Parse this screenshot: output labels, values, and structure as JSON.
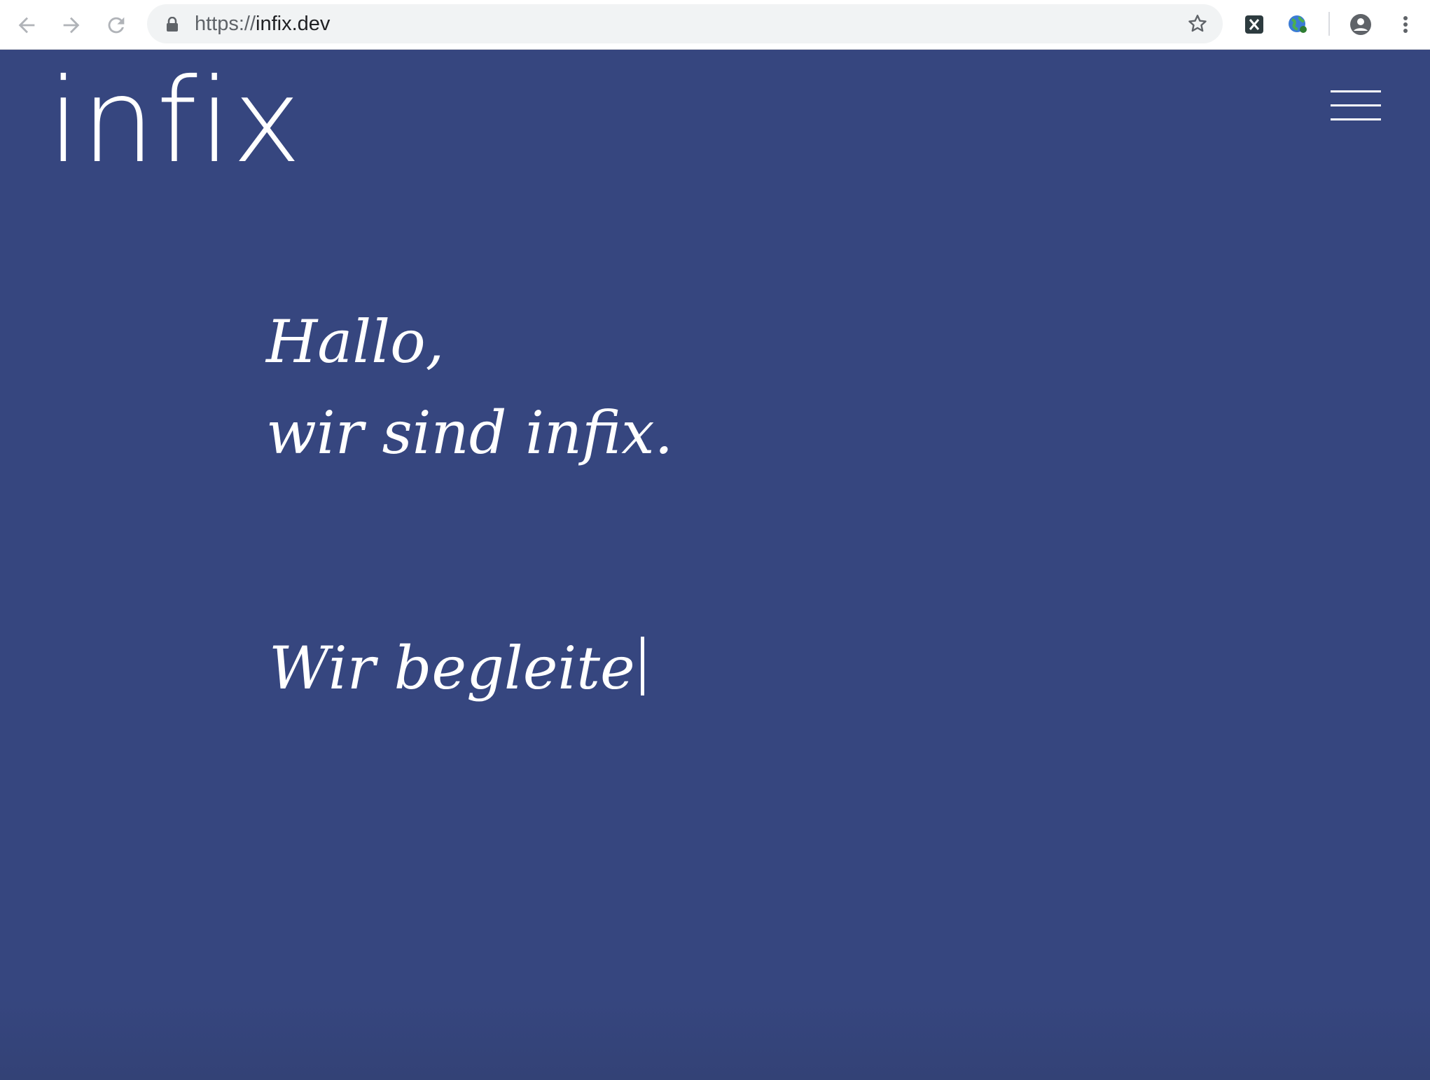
{
  "browser": {
    "url_scheme": "https://",
    "url_host": "infix.dev",
    "icons": {
      "back": "arrow-left-icon",
      "forward": "arrow-right-icon",
      "reload": "reload-icon",
      "lock": "lock-icon",
      "bookmark": "star-icon",
      "extension_1": "x-extension-icon",
      "extension_2": "globe-icon",
      "profile": "account-icon",
      "menu": "kebab-menu-icon"
    }
  },
  "site": {
    "logo": "infix",
    "menu_icon": "hamburger-icon",
    "hero": {
      "line1": "Hallo,",
      "line2": "wir sind infix.",
      "typed": "Wir begleite"
    },
    "colors": {
      "background": "#36467f",
      "text": "#ffffff"
    }
  }
}
